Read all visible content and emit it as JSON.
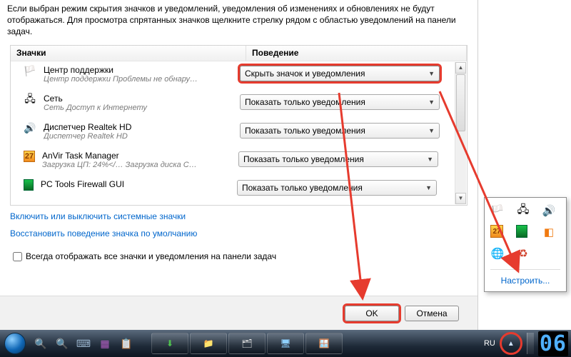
{
  "dialog": {
    "description": "Если выбран режим скрытия значков и уведомлений, уведомления об изменениях и обновлениях не будут отображаться. Для просмотра спрятанных значков щелкните стрелку рядом с областью уведомлений на панели задач.",
    "columns": {
      "icons": "Значки",
      "behavior": "Поведение"
    },
    "rows": [
      {
        "icon": "flag",
        "name": "Центр поддержки",
        "desc": "Центр поддержки  Проблемы не обнару…",
        "behavior": "Скрыть значок и уведомления",
        "hl": true
      },
      {
        "icon": "net",
        "name": "Сеть",
        "desc": "Сеть Доступ к Интернету",
        "behavior": "Показать только уведомления"
      },
      {
        "icon": "speaker",
        "name": "Диспетчер Realtek HD",
        "desc": "Диспетчер Realtek HD",
        "behavior": "Показать только уведомления"
      },
      {
        "icon": "anvir",
        "name": "AnVir Task Manager",
        "desc": "Загрузка ЦП: 24%</…   Загрузка диска  С…",
        "behavior": "Показать только уведомления"
      },
      {
        "icon": "shield",
        "name": "PC Tools Firewall GUI",
        "desc": "",
        "behavior": "Показать только уведомления"
      }
    ],
    "links": {
      "toggle_system": "Включить или выключить системные значки",
      "restore_default": "Восстановить поведение значка по умолчанию"
    },
    "checkbox_label": "Всегда отображать все значки и уведомления на панели задач",
    "buttons": {
      "ok": "OK",
      "cancel": "Отмена"
    }
  },
  "popup": {
    "icons": [
      "flag",
      "net",
      "speaker",
      "anvir",
      "shield",
      "orange",
      "globe",
      "cc"
    ],
    "link": "Настроить..."
  },
  "taskbar": {
    "lang": "RU",
    "clock_fragment": "06"
  }
}
